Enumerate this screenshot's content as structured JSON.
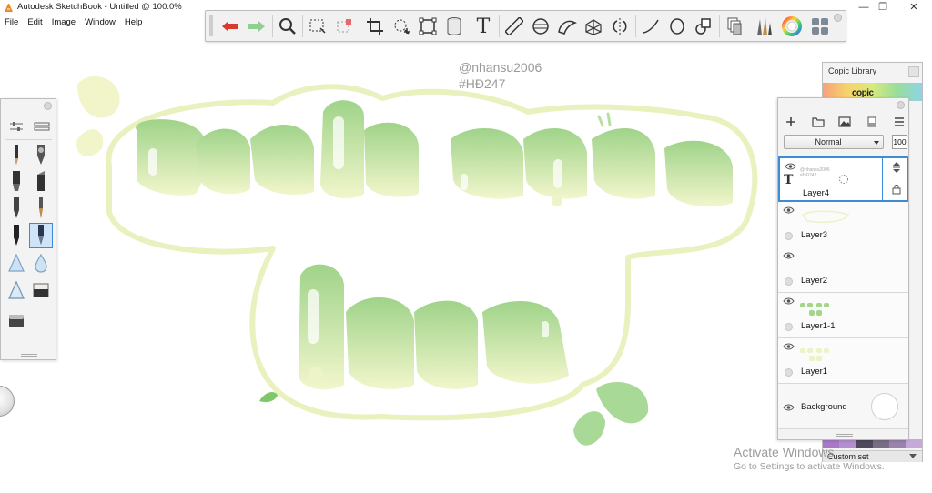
{
  "window": {
    "title": "Autodesk SketchBook - Untitled @ 100.0%",
    "controls": [
      "—",
      "❐",
      "✕"
    ]
  },
  "menu": [
    "File",
    "Edit",
    "Image",
    "Window",
    "Help"
  ],
  "toolbar": {
    "tools": [
      {
        "name": "undo-icon",
        "color": "#d93a2b"
      },
      {
        "name": "redo-icon",
        "color": "#8fd08f"
      },
      {
        "name": "zoom-icon"
      },
      {
        "name": "rect-select-icon"
      },
      {
        "name": "select-transform-icon"
      },
      {
        "name": "crop-icon"
      },
      {
        "name": "lasso-move-icon"
      },
      {
        "name": "distort-icon"
      },
      {
        "name": "fill-bucket-icon"
      },
      {
        "name": "text-icon",
        "glyph": "T"
      },
      {
        "name": "ruler-icon"
      },
      {
        "name": "ellipse-guide-icon"
      },
      {
        "name": "french-curve-icon"
      },
      {
        "name": "perspective-icon"
      },
      {
        "name": "symmetry-icon"
      },
      {
        "name": "stroke-line-icon"
      },
      {
        "name": "ellipse-icon"
      },
      {
        "name": "shapes-icon"
      },
      {
        "name": "copic-library-icon"
      },
      {
        "name": "brushes-icon"
      },
      {
        "name": "color-wheel-icon"
      },
      {
        "name": "swatches-icon"
      }
    ]
  },
  "watermark": {
    "line1": "@nhansu2006",
    "line2": "#HĐ247"
  },
  "copic": {
    "title": "Copic Library",
    "logo": "copic",
    "custom_set": "Custom set",
    "swatch_colors": [
      "#a879c8",
      "#b48fcf",
      "#4f4a5c",
      "#7a6e86",
      "#9a84ad",
      "#c6a9d9"
    ]
  },
  "layers": {
    "blend_mode": "Normal",
    "opacity": "100",
    "items": [
      {
        "name": "Layer4",
        "type": "text",
        "thumb_text": "@nhansu2006 #HĐ247"
      },
      {
        "name": "Layer3"
      },
      {
        "name": "Layer2"
      },
      {
        "name": "Layer1-1"
      },
      {
        "name": "Layer1"
      }
    ],
    "background": "Background"
  },
  "os_watermark": {
    "line1": "Activate Windows",
    "line2": "Go to Settings to activate Windows."
  },
  "colors": {
    "green_dark": "#9fd389",
    "green_light": "#d8efc6",
    "cream": "#f1f5c9",
    "selection_blue": "#3b8bd6"
  }
}
